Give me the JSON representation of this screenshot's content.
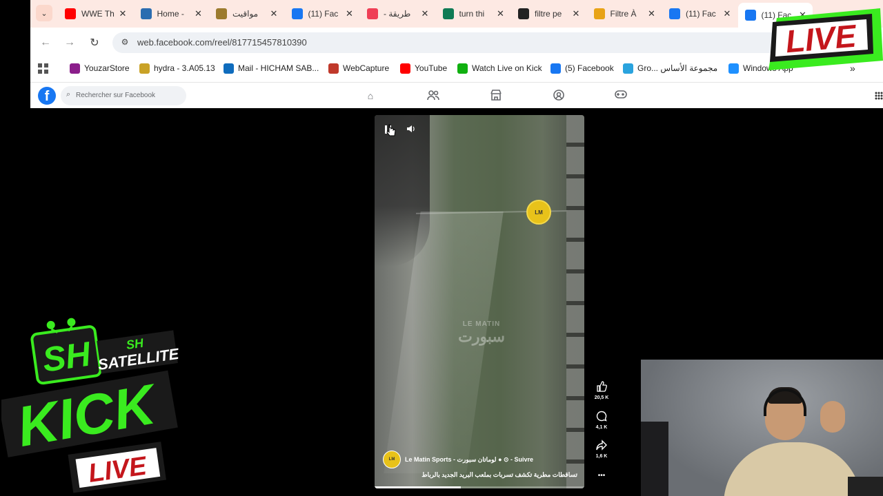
{
  "browser": {
    "tabs": [
      {
        "title": "WWE Th",
        "icon": "youtube-icon",
        "color": "#ff0000"
      },
      {
        "title": "Home -",
        "icon": "site-favicon",
        "color": "#2b6cb0"
      },
      {
        "title": "مواقيت",
        "icon": "emblem-icon",
        "color": "#9c7b2e"
      },
      {
        "title": "(11) Fac",
        "icon": "facebook-icon",
        "color": "#1877f2"
      },
      {
        "title": "- طريقة",
        "icon": "pocket-icon",
        "color": "#ef3f56"
      },
      {
        "title": "turn thi",
        "icon": "logo-icon",
        "color": "#0f7b55"
      },
      {
        "title": "filtre pe",
        "icon": "amazon-icon",
        "color": "#222222"
      },
      {
        "title": "Filtre À",
        "icon": "site-favicon",
        "color": "#e8a317"
      },
      {
        "title": "(11) Fac",
        "icon": "facebook-icon",
        "color": "#1877f2"
      },
      {
        "title": "(11) Fac",
        "icon": "facebook-icon",
        "color": "#1877f2"
      }
    ],
    "url": "web.facebook.com/reel/817715457810390",
    "bookmarks": [
      {
        "label": "YouzarStore",
        "color": "#8b1e8b"
      },
      {
        "label": "hydra - 3.A05.13",
        "color": "#c9a227"
      },
      {
        "label": "Mail - HICHAM SAB...",
        "color": "#0f6cbd"
      },
      {
        "label": "WebCapture",
        "color": "#c0392b"
      },
      {
        "label": "YouTube",
        "color": "#ff0000"
      },
      {
        "label": "Watch Live on Kick",
        "color": "#10b010"
      },
      {
        "label": "(5) Facebook",
        "color": "#1877f2"
      },
      {
        "label": "Gro... مجموعة الأساس",
        "color": "#2aa3de"
      },
      {
        "label": "Windows App",
        "color": "#1e90ff"
      }
    ]
  },
  "facebook": {
    "search_placeholder": "Rechercher sur Facebook",
    "nav_icons": [
      "home-icon",
      "friends-icon",
      "marketplace-icon",
      "groups-icon",
      "gaming-icon"
    ]
  },
  "reel": {
    "watermark_line1": "LE MATIN",
    "watermark_line2": "سبورت",
    "channel": "Le Matin Sports - لوماتان سبورت ● ⊙ - Suivre",
    "caption": "تساقطات مطرية تكشف تسربات بملعب البريد الجديد بالرباط",
    "likes": "20,5 K",
    "comments": "4,1 K",
    "shares": "1,6 K",
    "more": "•••",
    "progress": 0.41
  },
  "overlay": {
    "live_badge": "LIVE",
    "kick_brand_top": "SH",
    "kick_brand_sub": "SATELLITE",
    "kick_word": "KICK",
    "kick_live": "LIVE",
    "green": "#3aeb1f",
    "dark": "#1a1a1a"
  }
}
